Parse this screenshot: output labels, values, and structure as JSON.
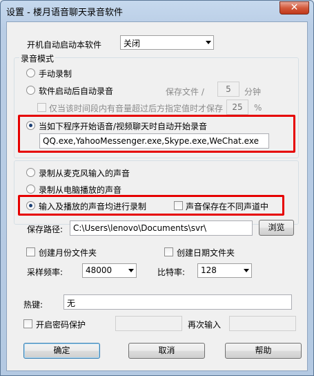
{
  "window": {
    "title": "设置 - 楼月语音聊天录音软件",
    "close_glyph": "✕"
  },
  "startup": {
    "label": "开机自动启动本软件",
    "value": "关闭"
  },
  "record_mode": {
    "title": "录音模式",
    "manual": "手动录制",
    "auto_on_start": "软件启动后自动录音",
    "save_every_label": "保存文件 /",
    "save_every_value": "5",
    "save_every_unit": "分钟",
    "only_when_volume": "仅当该时间段内有音量超过后方指定值时才保存",
    "volume_value": "25",
    "volume_unit": "%",
    "on_program_start": "当如下程序开始语音/视频聊天时自动开始录音",
    "programs": "QQ.exe,YahooMessenger.exe,Skype.exe,WeChat.exe"
  },
  "source": {
    "mic": "录制从麦克风输入的声音",
    "speaker": "录制从电脑播放的声音",
    "both": "输入及播放的声音均进行录制",
    "separate_channels": "声音保存在不同声道中"
  },
  "save_path": {
    "label": "保存路径:",
    "value": "C:\\Users\\lenovo\\Documents\\svr\\",
    "browse": "浏览"
  },
  "folders": {
    "monthly": "创建月份文件夹",
    "daily": "创建日期文件夹"
  },
  "sample_rate": {
    "label": "采样频率:",
    "value": "48000"
  },
  "bitrate": {
    "label": "比特率:",
    "value": "128"
  },
  "hotkey": {
    "label": "热键:",
    "value": "无"
  },
  "password": {
    "enable": "开启密码保护",
    "repeat_label": "再次输入"
  },
  "buttons": {
    "ok": "确定",
    "cancel": "取消",
    "help": "帮助"
  }
}
